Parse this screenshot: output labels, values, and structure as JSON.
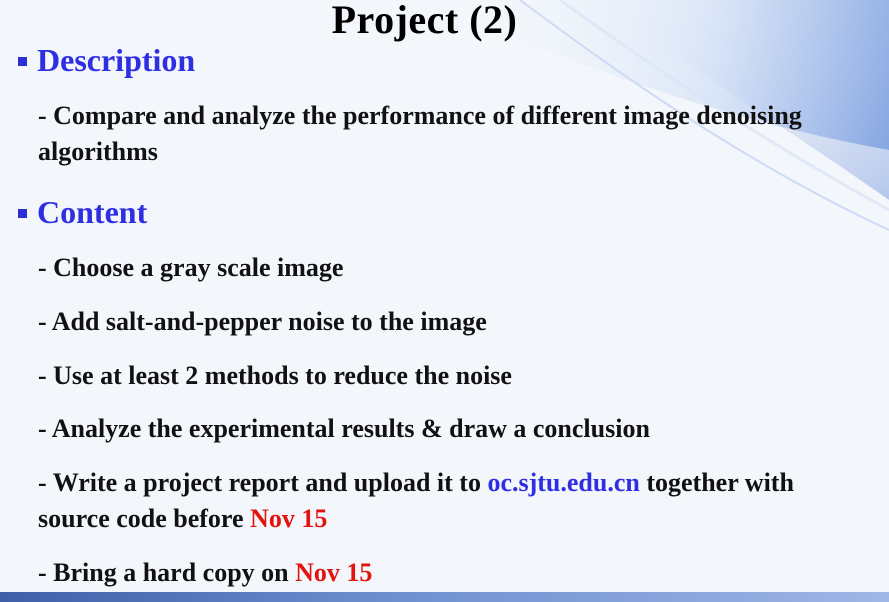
{
  "slide": {
    "title": "Project (2)",
    "colors": {
      "heading": "#2e2fe3",
      "link": "#2e2fe3",
      "date": "#e3130f",
      "body": "#111111"
    },
    "sections": [
      {
        "heading": "Description",
        "bullet_icon": "square-bullet-icon",
        "items": [
          "- Compare and analyze the performance of different image denoising algorithms"
        ]
      },
      {
        "heading": "Content",
        "bullet_icon": "square-bullet-icon",
        "items": [
          "- Choose a gray scale image",
          "- Add salt-and-pepper noise to the image",
          "- Use at least 2 methods to reduce the noise",
          "- Analyze the experimental results & draw a conclusion"
        ]
      }
    ],
    "report_item": {
      "prefix": "- Write a project report and upload it to ",
      "link": "oc.sjtu.edu.cn",
      "middle": " together with source code before ",
      "date": "Nov 15"
    },
    "copy_item": {
      "prefix": "- Bring a hard copy on ",
      "date": "Nov 15"
    }
  }
}
